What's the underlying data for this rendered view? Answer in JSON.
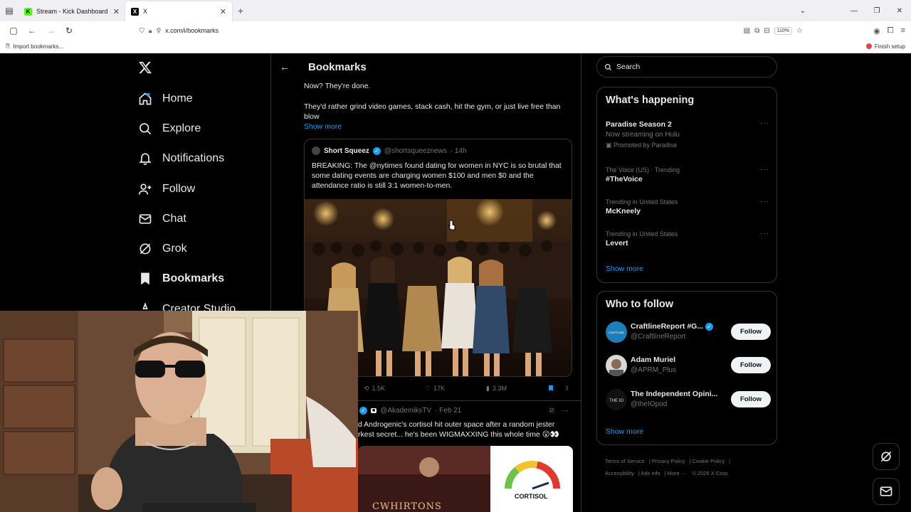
{
  "browser": {
    "tabs": [
      {
        "title": "Stream - Kick Dashboard",
        "active": false
      },
      {
        "title": "X",
        "active": true
      }
    ],
    "url": "x.com/i/bookmarks",
    "zoom": "110%",
    "bookmark_import": "Import bookmarks...",
    "finish_setup": "Finish setup"
  },
  "nav": {
    "logo": "X",
    "items": [
      {
        "label": "Home",
        "icon": "home-icon"
      },
      {
        "label": "Explore",
        "icon": "search-icon"
      },
      {
        "label": "Notifications",
        "icon": "bell-icon"
      },
      {
        "label": "Follow",
        "icon": "add-person-icon"
      },
      {
        "label": "Chat",
        "icon": "mail-icon"
      },
      {
        "label": "Grok",
        "icon": "grok-icon"
      },
      {
        "label": "Bookmarks",
        "icon": "bookmark-icon"
      },
      {
        "label": "Creator Studio",
        "icon": "creator-studio-icon"
      }
    ]
  },
  "main": {
    "title": "Bookmarks",
    "post1": {
      "text_line1": "Now? They're done.",
      "text_line2": "They'd rather grind video games, stack cash, hit the gym, or just live free than blow",
      "show_more": "Show more",
      "quote": {
        "name": "Short Squeez",
        "handle": "@shortsqueeznews",
        "time": "· 14h",
        "text": "BREAKING: The @nytimes found dating for women in NYC is so brutal that some dating events are charging women $100 and men $0 and the attendance ratio is still 3:1 women-to-men."
      },
      "stats": {
        "reposts": "1.5K",
        "likes": "17K",
        "views": "3.3M"
      }
    },
    "post2": {
      "handle": "@AkademiksTV",
      "time": "· Feb 21",
      "text_line1": "d Androgenic's cortisol hit outer space after a random jester",
      "text_line2": "rkest secret... he's been WIGMAXXING this whole time 😮👀",
      "image_text_left": "CWHIRTONS",
      "image_text_right": "CORTISOL"
    }
  },
  "sidebar": {
    "search_placeholder": "Search",
    "happening": {
      "title": "What's happening",
      "trends": [
        {
          "meta": "",
          "name": "Paradise Season 2",
          "sub": "Now streaming on Hulu",
          "promo": "Promoted by Paradise"
        },
        {
          "meta": "The Voice (US) · Trending",
          "name": "#TheVoice",
          "sub": "",
          "promo": ""
        },
        {
          "meta": "Trending in United States",
          "name": "McKneely",
          "sub": "",
          "promo": ""
        },
        {
          "meta": "Trending in United States",
          "name": "Levert",
          "sub": "",
          "promo": ""
        }
      ],
      "show_more": "Show more"
    },
    "who_to_follow": {
      "title": "Who to follow",
      "accounts": [
        {
          "name": "CraftlineReport #G...",
          "handle": "@CraftlineReport",
          "verified": true,
          "avatar_text": "CRAFTLINE",
          "button": "Follow"
        },
        {
          "name": "Adam Muriel",
          "handle": "@APRM_Plus",
          "verified": false,
          "avatar_text": "",
          "button": "Follow"
        },
        {
          "name": "The Independent Opini...",
          "handle": "@theIOpod",
          "verified": false,
          "avatar_text": "THE IO",
          "button": "Follow"
        }
      ],
      "show_more": "Show more"
    },
    "footer": {
      "terms": "Terms of Service",
      "privacy": "Privacy Policy",
      "cookie": "Cookie Policy",
      "accessibility": "Accessibility",
      "ads": "Ads info",
      "more": "More ···",
      "copyright": "© 2026 X Corp."
    }
  },
  "colors": {
    "accent": "#1d9bf0",
    "border": "#2f3336",
    "muted": "#71767b",
    "text": "#e7e9ea"
  }
}
